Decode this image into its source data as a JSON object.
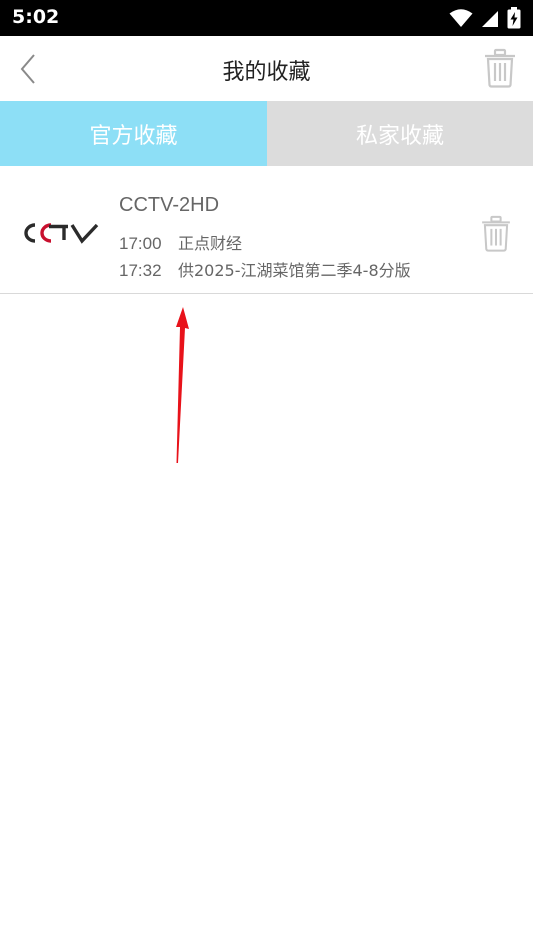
{
  "status_bar": {
    "time": "5:02",
    "icons": [
      "wifi-icon",
      "signal-icon",
      "battery-charging-icon"
    ]
  },
  "header": {
    "title": "我的收藏",
    "back_icon": "back-chevron-icon",
    "delete_icon": "trash-icon"
  },
  "tabs": [
    {
      "label": "官方收藏",
      "active": true,
      "color": "#8ddff6"
    },
    {
      "label": "私家收藏",
      "active": false,
      "color": "#dcdcdc"
    }
  ],
  "favorites": [
    {
      "logo_text": "CCTV",
      "channel": "CCTV-2HD",
      "programs": [
        {
          "time": "17:00",
          "name": "正点财经"
        },
        {
          "time": "17:32",
          "name": "供2025-江湖菜馆第二季4-8分版"
        }
      ],
      "delete_icon": "trash-icon"
    }
  ],
  "colors": {
    "accent": "#8ddff6",
    "inactive_tab": "#dcdcdc",
    "annotation_arrow": "#e8121a"
  }
}
